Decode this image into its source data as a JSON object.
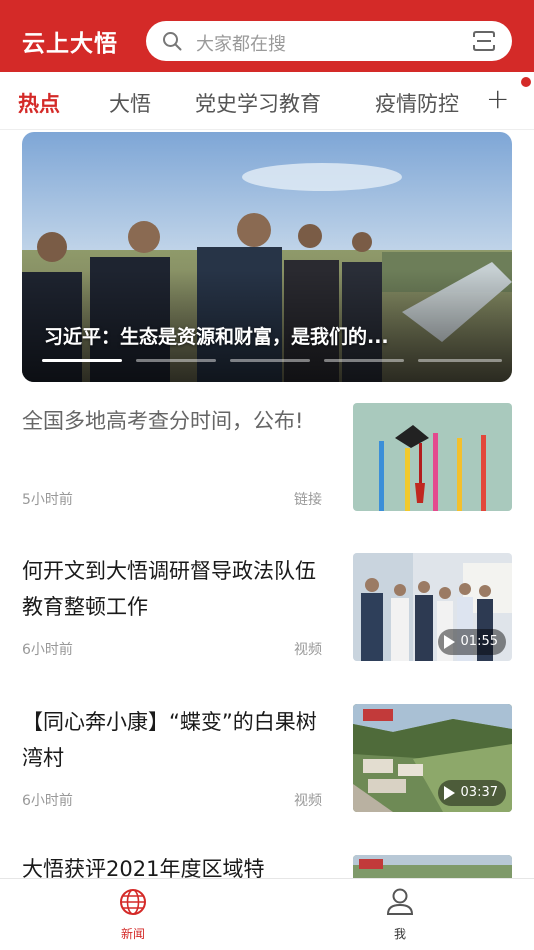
{
  "header": {
    "app_title": "云上大悟",
    "search_placeholder": "大家都在搜",
    "brand_color": "#d42a28"
  },
  "tabs": [
    {
      "label": "热点",
      "active": true
    },
    {
      "label": "大悟",
      "active": false
    },
    {
      "label": "党史学习教育",
      "active": false
    },
    {
      "label": "疫情防控",
      "active": false
    }
  ],
  "tab_more_label": "+",
  "hero": {
    "caption": "习近平：生态是资源和财富，是我们的...",
    "slide_count": 5,
    "active_slide": 1
  },
  "news": [
    {
      "title": "全国多地高考查分时间，公布!",
      "time": "5小时前",
      "type": "链接",
      "duration": "",
      "read": true
    },
    {
      "title": "何开文到大悟调研督导政法队伍教育整顿工作",
      "time": "6小时前",
      "type": "视频",
      "duration": "01:55",
      "read": false
    },
    {
      "title": "【同心奔小康】“蝶变”的白果树湾村",
      "time": "6小时前",
      "type": "视频",
      "duration": "03:37",
      "read": false
    },
    {
      "title": "大悟获评2021年度区域特",
      "time": "",
      "type": "",
      "duration": "",
      "read": false
    }
  ],
  "bottom_nav": [
    {
      "label": "新闻",
      "icon": "globe-icon",
      "active": true
    },
    {
      "label": "我",
      "icon": "user-icon",
      "active": false
    }
  ]
}
